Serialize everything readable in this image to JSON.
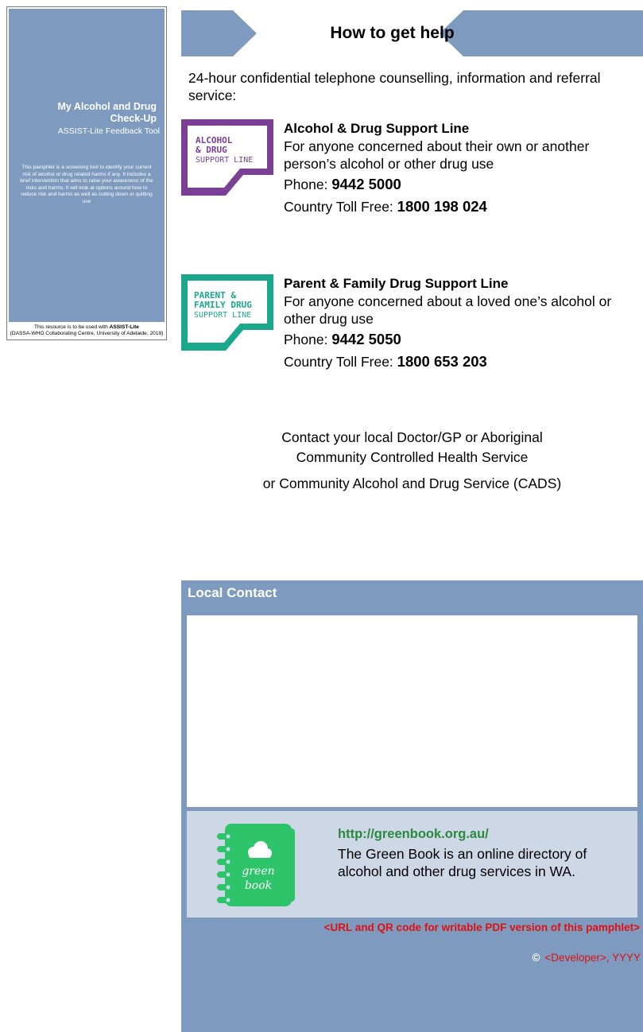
{
  "cover": {
    "title_line1": "My Alcohol and Drug",
    "title_line2": "Check-Up",
    "subtitle": "ASSIST-Lite Feedback Tool",
    "description": "This pamphlet is a screening tool to identify your current risk of alcohol or drug related harms if any. It includes a brief intervention that aims to raise your awareness of the risks and harms. It will look at options around how to reduce risk and harms as well as cutting down or quitting use",
    "footer_prefix": "This resource is to be used with ",
    "footer_bold": "ASSIST-Lite",
    "footer_line2": "(DASSA-WHO Collaborating Centre, University of Adelaide, 2019)"
  },
  "header": {
    "title": "How to get help"
  },
  "intro": "24-hour confidential telephone counselling, information and referral service:",
  "services": [
    {
      "logo_text": [
        "ALCOHOL",
        "& DRUG",
        "SUPPORT LINE"
      ],
      "name": "Alcohol & Drug Support Line",
      "description": "For anyone concerned about their own or another person’s alcohol or other drug use",
      "phone_label": "Phone: ",
      "phone": "9442 5000",
      "toll_label": "Country Toll Free: ",
      "toll": "1800 198 024"
    },
    {
      "logo_text": [
        "PARENT &",
        "FAMILY DRUG",
        "SUPPORT LINE"
      ],
      "name": "Parent & Family Drug Support Line",
      "description": "For anyone concerned about a loved one’s alcohol or other drug use",
      "phone_label": "Phone: ",
      "phone": "9442 5050",
      "toll_label": "Country Toll Free: ",
      "toll": "1800 653 203"
    }
  ],
  "contact": {
    "line1": "Contact your local Doctor/GP or Aboriginal",
    "line2": "Community Controlled Health Service",
    "line3": "or Community Alcohol and Drug Service (CADS)"
  },
  "local_contact": {
    "title": "Local Contact",
    "greenbook_logo_text": [
      "green",
      "book"
    ],
    "greenbook_url": "http://greenbook.org.au/",
    "greenbook_desc": "The Green Book is an online directory of alcohol and other drug services in WA.",
    "pdf_note": "<URL and QR code for writable PDF version of this pamphlet>",
    "copyright_symbol": "©",
    "developer": "<Developer>, YYYY"
  },
  "colors": {
    "panel_blue": "#7e9bbf",
    "adsl_purple": "#7b3f96",
    "pfdsl_teal": "#1aa88c",
    "greenbook_green": "#2ec56a",
    "note_red": "#e01010"
  }
}
